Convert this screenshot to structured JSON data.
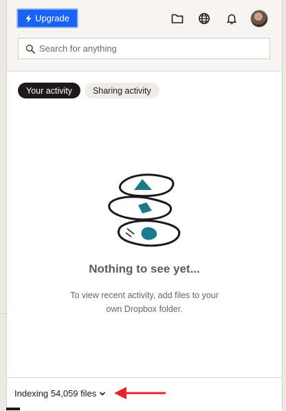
{
  "header": {
    "upgrade_label": "Upgrade",
    "icons": [
      "folder-icon",
      "globe-icon",
      "bell-icon"
    ],
    "accent_color": "#1a62f2"
  },
  "search": {
    "placeholder": "Search for anything"
  },
  "tabs": [
    {
      "label": "Your activity",
      "active": true
    },
    {
      "label": "Sharing activity",
      "active": false
    }
  ],
  "empty_state": {
    "title": "Nothing to see yet...",
    "description": "To view recent activity, add files to your own Dropbox folder."
  },
  "footer": {
    "indexing_label": "Indexing 54,059 files",
    "annotation_color": "#e3242b"
  }
}
